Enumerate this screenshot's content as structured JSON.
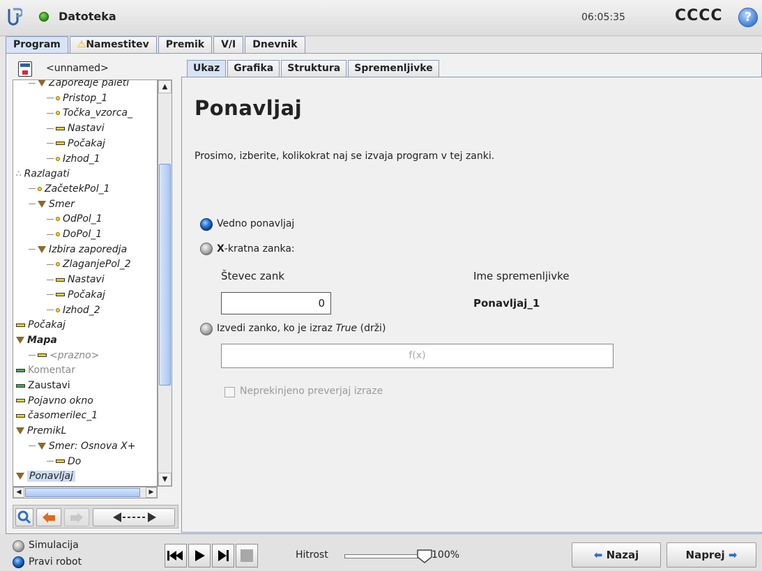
{
  "header": {
    "app_title": "Datoteka",
    "time": "06:05:35",
    "robot_name": "CCCC",
    "help_label": "?"
  },
  "main_tabs": [
    {
      "label": "Program",
      "active": true
    },
    {
      "label": "Namestitev",
      "warning": true
    },
    {
      "label": "Premik"
    },
    {
      "label": "V/I"
    },
    {
      "label": "Dnevnik"
    }
  ],
  "program": {
    "file_name": "<unnamed>"
  },
  "tree": [
    {
      "label": "Zaporedje paleti",
      "marker": "triangle",
      "level": 1
    },
    {
      "label": "Pristop_1",
      "marker": "dot",
      "level": 2
    },
    {
      "label": "Točka_vzorca_",
      "marker": "dot",
      "level": 2
    },
    {
      "label": "Nastavi",
      "marker": "bar",
      "level": 2
    },
    {
      "label": "Počakaj",
      "marker": "bar",
      "level": 2
    },
    {
      "label": "Izhod_1",
      "marker": "dot",
      "level": 2
    },
    {
      "label": "Razlagati",
      "marker": "knot",
      "level": 0
    },
    {
      "label": "ZačetekPol_1",
      "marker": "dot",
      "level": 1
    },
    {
      "label": "Smer",
      "marker": "triangle",
      "level": 1
    },
    {
      "label": "OdPol_1",
      "marker": "dot",
      "level": 2
    },
    {
      "label": "DoPol_1",
      "marker": "dot",
      "level": 2
    },
    {
      "label": "Izbira zaporedja",
      "marker": "triangle",
      "level": 1
    },
    {
      "label": "ZlaganjePol_2",
      "marker": "dot",
      "level": 2
    },
    {
      "label": "Nastavi",
      "marker": "bar",
      "level": 2
    },
    {
      "label": "Počakaj",
      "marker": "bar",
      "level": 2
    },
    {
      "label": "Izhod_2",
      "marker": "dot",
      "level": 2
    },
    {
      "label": "Počakaj",
      "marker": "bar",
      "level": 0
    },
    {
      "label": "Mapa",
      "marker": "triangle",
      "level": 0,
      "style": "bold"
    },
    {
      "label": "<prazno>",
      "marker": "bar",
      "level": 1,
      "style": "muted"
    },
    {
      "label": "Komentar",
      "marker": "bar-green",
      "level": 0,
      "style": "normal-muted"
    },
    {
      "label": "Zaustavi",
      "marker": "bar-green",
      "level": 0,
      "style": "normal"
    },
    {
      "label": "Pojavno okno",
      "marker": "bar",
      "level": 0
    },
    {
      "label": "časomerilec_1",
      "marker": "bar",
      "level": 0
    },
    {
      "label": "PremikL",
      "marker": "triangle",
      "level": 0
    },
    {
      "label": "Smer: Osnova X+",
      "marker": "triangle",
      "level": 1
    },
    {
      "label": "Do",
      "marker": "bar",
      "level": 2
    },
    {
      "label": "Ponavljaj",
      "marker": "triangle",
      "level": 0,
      "style": "selected"
    }
  ],
  "sub_tabs": [
    {
      "label": "Ukaz",
      "active": true
    },
    {
      "label": "Grafika"
    },
    {
      "label": "Struktura"
    },
    {
      "label": "Spremenljivke"
    }
  ],
  "command": {
    "title": "Ponavljaj",
    "instruction": "Prosimo, izberite, kolikokrat naj se izvaja program v tej zanki.",
    "option_always": "Vedno ponavljaj",
    "option_x_bold": "X",
    "option_x_rest": "-kratna zanka:",
    "counter_label": "Števec zank",
    "counter_value": "0",
    "var_label": "Ime spremenljivke",
    "var_value": "Ponavljaj_1",
    "option_while_prefix": "Izvedi zanko, ko je izraz ",
    "option_while_italic": "True",
    "option_while_suffix": " (drži)",
    "expr_placeholder": "f(x)",
    "continuous_check": "Neprekinjeno preverjaj izraze",
    "selected_option": "always"
  },
  "footer": {
    "mode_sim": "Simulacija",
    "mode_real": "Pravi robot",
    "speed_label": "Hitrost",
    "speed_value": "100%",
    "speed_fraction": 1.0,
    "back_label": "Nazaj",
    "next_label": "Naprej"
  },
  "colors": {
    "accent_blue": "#2f6fc8",
    "tab_border": "#8a9ab8",
    "status_green": "#2d8a12",
    "warning_yellow": "#e8b400"
  }
}
